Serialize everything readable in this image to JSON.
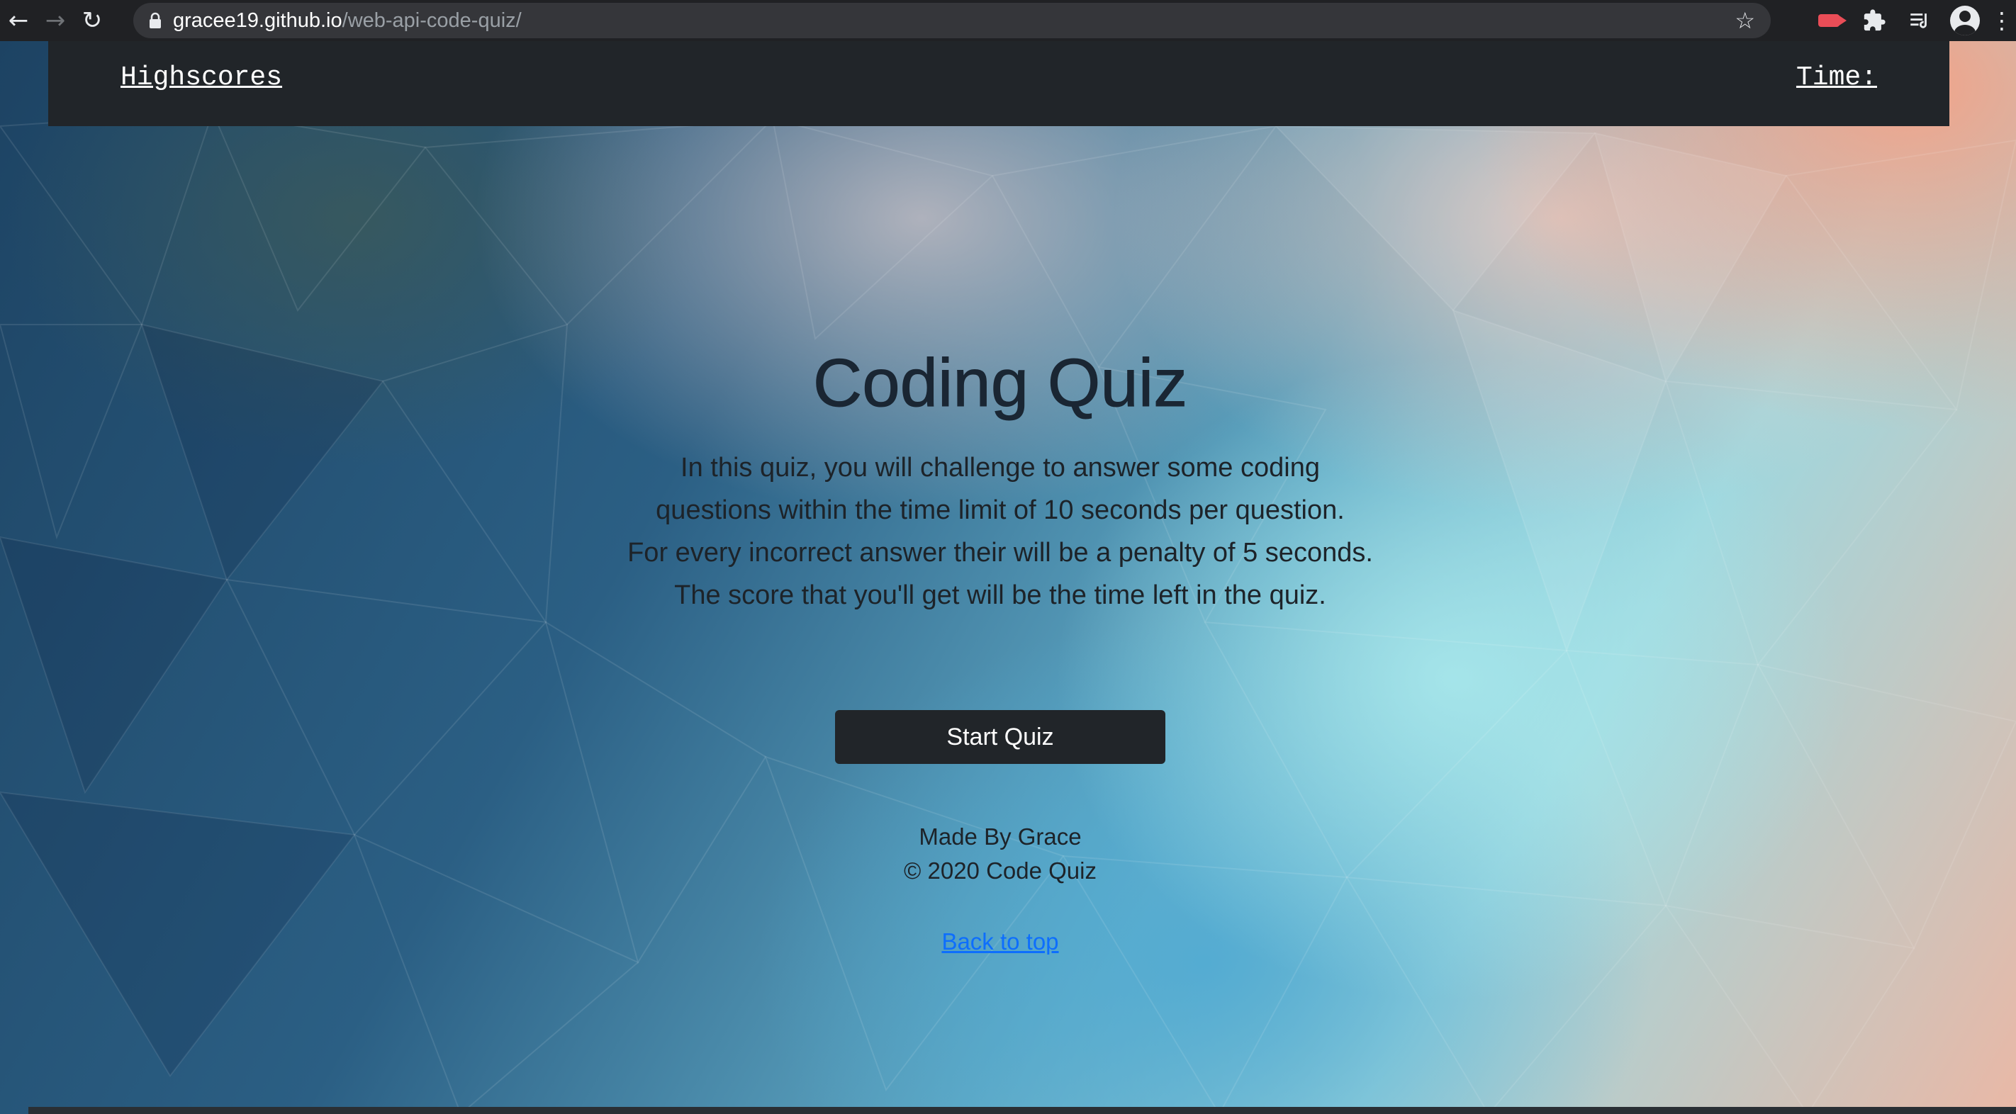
{
  "browser": {
    "url_host": "gracee19.github.io",
    "url_path": "/web-api-code-quiz/",
    "icons": [
      "back-arrow-icon",
      "forward-arrow-icon",
      "reload-icon",
      "lock-icon",
      "star-icon",
      "screen-record-icon",
      "extensions-icon",
      "reading-list-icon",
      "profile-icon",
      "menu-icon"
    ]
  },
  "header": {
    "highscores_label": "Highscores",
    "time_label": "Time:"
  },
  "main": {
    "title": "Coding Quiz",
    "intro_lines": [
      "In this quiz, you will challenge to answer some coding",
      "questions within the time limit of 10 seconds per question.",
      "For every incorrect answer their will be a penalty of 5 seconds.",
      "The score that you'll get will be the time left in the quiz."
    ],
    "start_button_label": "Start Quiz"
  },
  "footer": {
    "made_by": "Made By Grace",
    "copyright": "© 2020 Code Quiz",
    "back_to_top": "Back to top"
  },
  "colors": {
    "header_bg": "#212529",
    "button_bg": "#212529",
    "link": "#0d6efd"
  }
}
